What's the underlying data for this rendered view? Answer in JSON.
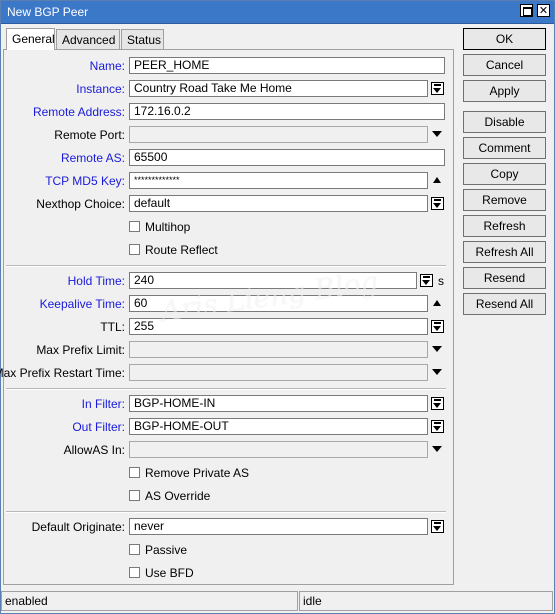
{
  "window": {
    "title": "New BGP Peer"
  },
  "tabs": [
    {
      "label": "General",
      "active": true
    },
    {
      "label": "Advanced",
      "active": false
    },
    {
      "label": "Status",
      "active": false
    }
  ],
  "fields": {
    "name": {
      "label": "Name:",
      "value": "PEER_HOME"
    },
    "instance": {
      "label": "Instance:",
      "value": "Country Road Take Me Home"
    },
    "remote_address": {
      "label": "Remote Address:",
      "value": "172.16.0.2"
    },
    "remote_port": {
      "label": "Remote Port:",
      "value": ""
    },
    "remote_as": {
      "label": "Remote AS:",
      "value": "65500"
    },
    "tcp_md5_key": {
      "label": "TCP MD5 Key:",
      "value": "*************"
    },
    "nexthop_choice": {
      "label": "Nexthop Choice:",
      "value": "default"
    },
    "hold_time": {
      "label": "Hold Time:",
      "value": "240",
      "unit": "s"
    },
    "keepalive_time": {
      "label": "Keepalive Time:",
      "value": "60"
    },
    "ttl": {
      "label": "TTL:",
      "value": "255"
    },
    "max_prefix_limit": {
      "label": "Max Prefix Limit:",
      "value": ""
    },
    "max_prefix_restart_time": {
      "label": "Max Prefix Restart Time:",
      "value": ""
    },
    "in_filter": {
      "label": "In Filter:",
      "value": "BGP-HOME-IN"
    },
    "out_filter": {
      "label": "Out Filter:",
      "value": "BGP-HOME-OUT"
    },
    "allowas_in": {
      "label": "AllowAS In:",
      "value": ""
    },
    "default_originate": {
      "label": "Default Originate:",
      "value": "never"
    }
  },
  "checkboxes": {
    "multihop": {
      "label": "Multihop",
      "checked": false
    },
    "route_reflect": {
      "label": "Route Reflect",
      "checked": false
    },
    "remove_private_as": {
      "label": "Remove Private AS",
      "checked": false
    },
    "as_override": {
      "label": "AS Override",
      "checked": false
    },
    "passive": {
      "label": "Passive",
      "checked": false
    },
    "use_bfd": {
      "label": "Use BFD",
      "checked": false
    }
  },
  "buttons": {
    "ok": "OK",
    "cancel": "Cancel",
    "apply": "Apply",
    "disable": "Disable",
    "comment": "Comment",
    "copy": "Copy",
    "remove": "Remove",
    "refresh": "Refresh",
    "refresh_all": "Refresh All",
    "resend": "Resend",
    "resend_all": "Resend All"
  },
  "statusbar": {
    "left": "enabled",
    "right": "idle"
  },
  "watermark": "Aris Lieng Blog",
  "colors": {
    "titlebar": "#3c78c8",
    "blue_label": "#1a1ad8",
    "background": "#f0f0f0"
  },
  "icons": [
    "maximize-icon",
    "close-icon",
    "dropdown-icon",
    "arrow-down-icon",
    "arrow-up-icon"
  ]
}
